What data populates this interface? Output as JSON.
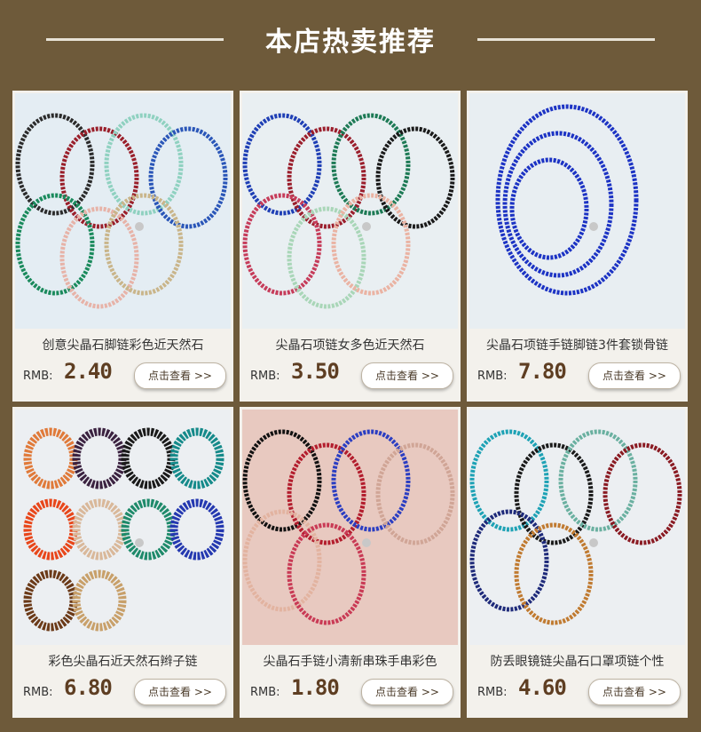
{
  "header": {
    "title": "本店热卖推荐"
  },
  "products": [
    {
      "name": "创意尖晶石脚链彩色近天然石",
      "currency": "RMB:",
      "price": "2.40",
      "button": "点击查看 >>",
      "bg": "#e4edf3",
      "colors": [
        "#2b2b2b",
        "#9a1f2a",
        "#8fd1c0",
        "#2a56b8",
        "#1a8a5c",
        "#e7b3a8",
        "#c9b58a"
      ]
    },
    {
      "name": "尖晶石项链女多色近天然石",
      "currency": "RMB:",
      "price": "3.50",
      "button": "点击查看 >>",
      "bg": "#e9eff2",
      "colors": [
        "#1f3fb5",
        "#9b1e2c",
        "#1d7a55",
        "#1a1a1a",
        "#c63c5a",
        "#a9d6b8",
        "#eab3a3"
      ]
    },
    {
      "name": "尖晶石项链手链脚链3件套锁骨链",
      "currency": "RMB:",
      "price": "7.80",
      "button": "点击查看 >>",
      "bg": "#e8eef2",
      "colors": [
        "#1c33c4",
        "#1c33c4",
        "#1c33c4"
      ]
    },
    {
      "name": "彩色尖晶石近天然石辫子链",
      "currency": "RMB:",
      "price": "6.80",
      "button": "点击查看 >>",
      "bg": "#eceff2",
      "colors": [
        "#e07a3a",
        "#3b2240",
        "#1a1a1a",
        "#158a8a",
        "#e8461a",
        "#d9b89a",
        "#1e8a6a",
        "#2438b0",
        "#6b3a18",
        "#c8a06a"
      ]
    },
    {
      "name": "尖晶石手链小清新串珠手串彩色",
      "currency": "RMB:",
      "price": "1.80",
      "button": "点击查看 >>",
      "bg": "#e8c9c0",
      "colors": [
        "#111111",
        "#b31d2d",
        "#2b3ec2",
        "#d0a596",
        "#e2b3a0",
        "#c93a55"
      ]
    },
    {
      "name": "防丢眼镜链尖晶石口罩项链个性",
      "currency": "RMB:",
      "price": "4.60",
      "button": "点击查看 >>",
      "bg": "#eceff2",
      "colors": [
        "#1ea2b5",
        "#1a1a1a",
        "#6ab0a0",
        "#8a1a22",
        "#1e2a7a",
        "#c07a30"
      ]
    }
  ]
}
